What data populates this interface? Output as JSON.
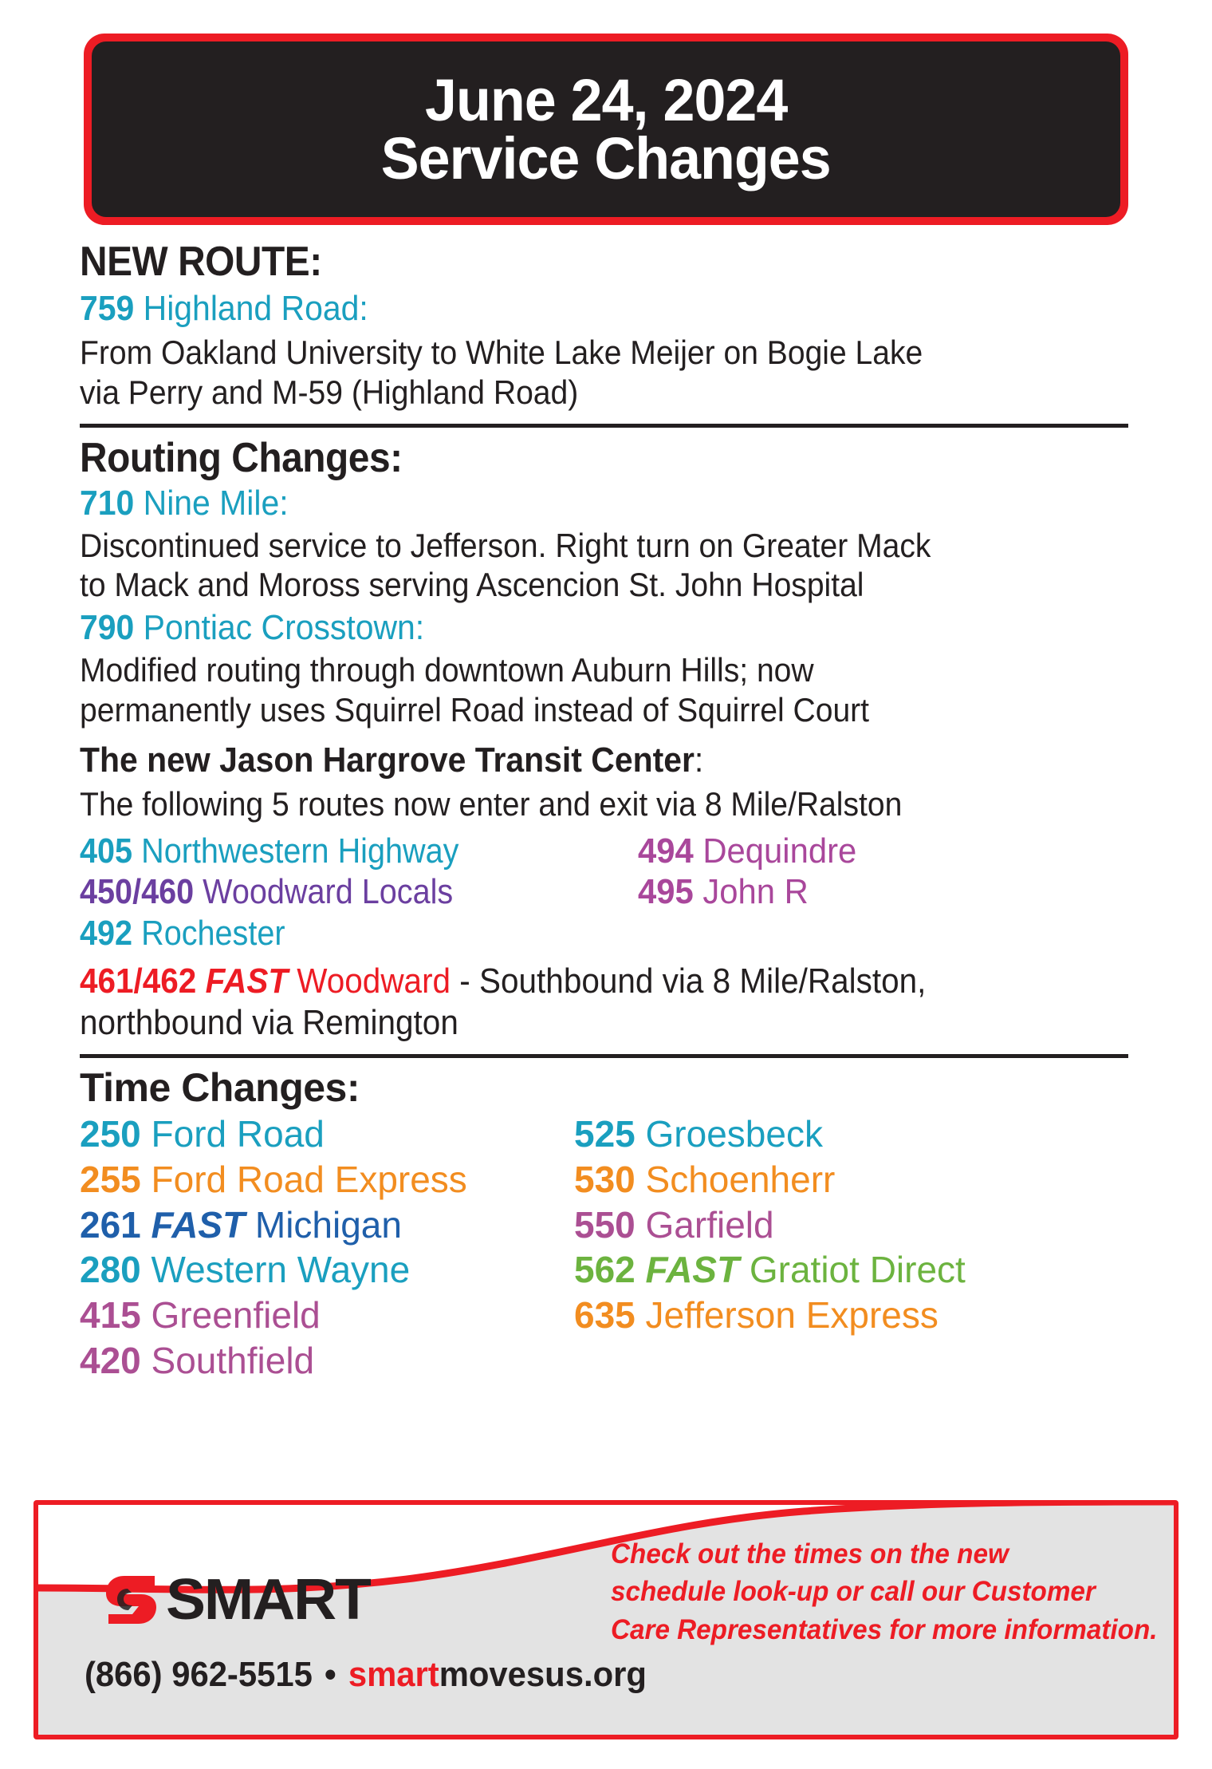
{
  "header": {
    "line1": "June 24, 2024",
    "line2": "Service Changes",
    "banner_border_color": "#ed1c24",
    "banner_fill_color": "#231f20"
  },
  "colors": {
    "teal": "#1a9fbf",
    "teal_alt": "#1b9dba",
    "purple": "#6b3fa0",
    "magenta": "#a9479b",
    "orchid": "#ab4f93",
    "red": "#ed1c24",
    "blue": "#1f5faa",
    "orange": "#f28d20",
    "green": "#6cb33f",
    "black": "#231f20"
  },
  "new_route": {
    "heading": "NEW ROUTE:",
    "route_number": "759",
    "route_name": "Highland Road:",
    "description_line1": "From Oakland University to White Lake Meijer on Bogie Lake",
    "description_line2": "via Perry and M-59 (Highland Road)"
  },
  "routing_changes": {
    "heading": "Routing Changes:",
    "items": [
      {
        "number": "710",
        "name": "Nine Mile:",
        "desc_line1": "Discontinued service to Jefferson. Right turn on Greater Mack",
        "desc_line2": "to Mack and Moross serving Ascencion St. John Hospital"
      },
      {
        "number": "790",
        "name": "Pontiac Crosstown:",
        "desc_line1": "Modified routing through downtown Auburn Hills; now",
        "desc_line2": "permanently uses Squirrel Road instead of Squirrel Court"
      }
    ],
    "hargrove": {
      "title_bold": "The new Jason Hargrove Transit Center",
      "title_tail": ":",
      "subtitle": "The following 5 routes now enter and exit via 8 Mile/Ralston",
      "routes": [
        {
          "number": "405",
          "name": "Northwestern Highway",
          "color": "#1a9fbf"
        },
        {
          "number": "494",
          "name": "Dequindre",
          "color": "#a9479b"
        },
        {
          "number": "450/460",
          "name": "Woodward Locals",
          "color": "#6b3fa0"
        },
        {
          "number": "495",
          "name": "John R",
          "color": "#a9479b"
        },
        {
          "number": "492",
          "name": "Rochester",
          "color": "#1a9fbf"
        }
      ],
      "fast_route": {
        "number": "461/462",
        "fast_label": "FAST",
        "name": "Woodward",
        "color": "#ed1c24",
        "desc_line1": " - Southbound via 8 Mile/Ralston,",
        "desc_line2": "northbound via Remington"
      }
    }
  },
  "time_changes": {
    "heading": "Time Changes:",
    "left_column": [
      {
        "number": "250",
        "name": "Ford Road",
        "color": "#1a9fbf",
        "fast": false
      },
      {
        "number": "255",
        "name": "Ford Road Express",
        "color": "#f28d20",
        "fast": false
      },
      {
        "number": "261",
        "name": "Michigan",
        "color": "#1f5faa",
        "fast": true,
        "fast_label": "FAST"
      },
      {
        "number": "280",
        "name": "Western Wayne",
        "color": "#1a9fbf",
        "fast": false
      },
      {
        "number": "415",
        "name": "Greenfield",
        "color": "#ab4f93",
        "fast": false
      },
      {
        "number": "420",
        "name": "Southfield",
        "color": "#ab4f93",
        "fast": false
      }
    ],
    "right_column": [
      {
        "number": "525",
        "name": "Groesbeck",
        "color": "#1a9fbf",
        "fast": false
      },
      {
        "number": "530",
        "name": "Schoenherr",
        "color": "#f28d20",
        "fast": false
      },
      {
        "number": "550",
        "name": "Garfield",
        "color": "#ab4f93",
        "fast": false
      },
      {
        "number": "562",
        "name": "Gratiot Direct",
        "color": "#6cb33f",
        "fast": true,
        "fast_label": "FAST"
      },
      {
        "number": "635",
        "name": "Jefferson Express",
        "color": "#f28d20",
        "fast": false
      }
    ]
  },
  "footer": {
    "logo_text": "SMART",
    "logo_icon": "smart-s-mark-icon",
    "phone": "(866) 962-5515",
    "separator": "•",
    "website_red": "smart",
    "website_black": "movesus.org",
    "promo_line1": "Check out the times on the new",
    "promo_line2": "schedule look-up or call our Customer",
    "promo_line3": "Care Representatives for more information."
  }
}
